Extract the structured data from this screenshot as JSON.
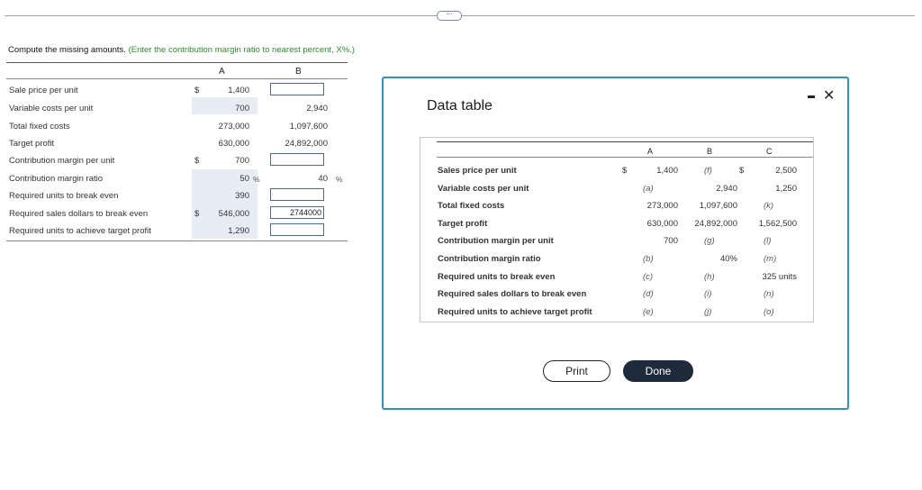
{
  "more_button": "⋯",
  "instruction": {
    "main": "Compute the missing amounts.",
    "hint": "(Enter the contribution margin ratio to nearest percent, X%.)"
  },
  "worksheet": {
    "col_a": "A",
    "col_b": "B",
    "rows": [
      {
        "label": "Sale price per unit",
        "dollar": "$",
        "a": "1,400",
        "a_pct": "",
        "b": "",
        "b_pct": "",
        "b_input": true,
        "b_input_value": ""
      },
      {
        "label": "Variable costs per unit",
        "dollar": "",
        "a": "700",
        "a_pct": "",
        "b": "2,940",
        "b_pct": "",
        "b_input": false,
        "b_input_value": ""
      },
      {
        "label": "Total fixed costs",
        "dollar": "",
        "a": "273,000",
        "a_pct": "",
        "b": "1,097,600",
        "b_pct": "",
        "b_input": false,
        "b_input_value": ""
      },
      {
        "label": "Target profit",
        "dollar": "",
        "a": "630,000",
        "a_pct": "",
        "b": "24,892,000",
        "b_pct": "",
        "b_input": false,
        "b_input_value": ""
      },
      {
        "label": "Contribution margin per unit",
        "dollar": "$",
        "a": "700",
        "a_pct": "",
        "b": "",
        "b_pct": "",
        "b_input": true,
        "b_input_value": ""
      },
      {
        "label": "Contribution margin ratio",
        "dollar": "",
        "a": "50",
        "a_pct": "%",
        "b": "40",
        "b_pct": "%",
        "b_input": false,
        "b_input_value": ""
      },
      {
        "label": "Required units to break even",
        "dollar": "",
        "a": "390",
        "a_pct": "",
        "b": "",
        "b_pct": "",
        "b_input": true,
        "b_input_value": ""
      },
      {
        "label": "Required sales dollars to break even",
        "dollar": "$",
        "a": "546,000",
        "a_pct": "",
        "b": "",
        "b_pct": "",
        "b_input": true,
        "b_input_value": "2744000"
      },
      {
        "label": "Required units to achieve target profit",
        "dollar": "",
        "a": "1,290",
        "a_pct": "",
        "b": "",
        "b_pct": "",
        "b_input": true,
        "b_input_value": ""
      }
    ]
  },
  "modal": {
    "title": "Data table",
    "minimize": "minimize",
    "close": "✕",
    "headers": {
      "a": "A",
      "b": "B",
      "c": "C"
    },
    "rows": [
      {
        "label": "Sales price per unit",
        "a_dollar": "$",
        "a": "1,400",
        "b": "(f)",
        "b_dollar": "$",
        "c": "2,500"
      },
      {
        "label": "Variable costs per unit",
        "a_dollar": "",
        "a": "(a)",
        "b": "2,940",
        "b_dollar": "",
        "c": "1,250"
      },
      {
        "label": "Total fixed costs",
        "a_dollar": "",
        "a": "273,000",
        "b": "1,097,600",
        "b_dollar": "",
        "c": "(k)"
      },
      {
        "label": "Target profit",
        "a_dollar": "",
        "a": "630,000",
        "b": "24,892,000",
        "b_dollar": "",
        "c": "1,562,500"
      },
      {
        "label": "Contribution margin per unit",
        "a_dollar": "",
        "a": "700",
        "b": "(g)",
        "b_dollar": "",
        "c": "(l)"
      },
      {
        "label": "Contribution margin ratio",
        "a_dollar": "",
        "a": "(b)",
        "b": "40%",
        "b_dollar": "",
        "c": "(m)"
      },
      {
        "label": "Required units to break even",
        "a_dollar": "",
        "a": "(c)",
        "b": "(h)",
        "b_dollar": "",
        "c": "325 units"
      },
      {
        "label": "Required sales dollars to break even",
        "a_dollar": "",
        "a": "(d)",
        "b": "(i)",
        "b_dollar": "",
        "c": "(n)"
      },
      {
        "label": "Required units to achieve target profit",
        "a_dollar": "",
        "a": "(e)",
        "b": "(j)",
        "b_dollar": "",
        "c": "(o)"
      }
    ],
    "print_label": "Print",
    "done_label": "Done"
  }
}
